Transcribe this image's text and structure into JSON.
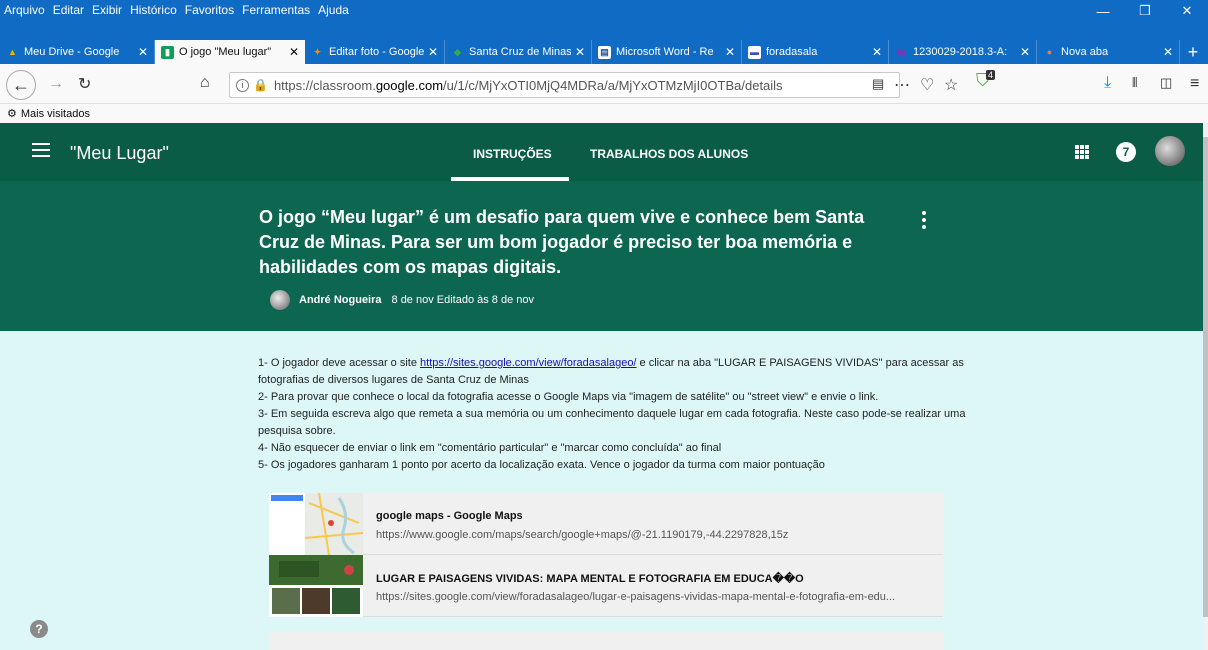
{
  "menu": [
    "Arquivo",
    "Editar",
    "Exibir",
    "Histórico",
    "Favoritos",
    "Ferramentas",
    "Ajuda"
  ],
  "window_controls": [
    "—",
    "❐",
    "✕"
  ],
  "tabs": [
    {
      "label": "Meu Drive - Google",
      "icon": "▲",
      "color": "#f4b400"
    },
    {
      "label": "O jogo \"Meu lugar\"",
      "icon": "▮",
      "color": "#0f9d58"
    },
    {
      "label": "Editar foto - Google",
      "icon": "✦",
      "color": "#ff8a00"
    },
    {
      "label": "Santa Cruz de Minas",
      "icon": "◆",
      "color": "#34a853"
    },
    {
      "label": "Microsoft Word - Re",
      "icon": "▤",
      "color": "#2b579a"
    },
    {
      "label": "foradasala",
      "icon": "▬",
      "color": "#3f51b5"
    },
    {
      "label": "1230029-2018.3-A:",
      "icon": "▥",
      "color": "#9c27b0"
    },
    {
      "label": "Nova aba",
      "icon": "●",
      "color": "#ff7139"
    }
  ],
  "url": {
    "pre": "https://classroom.",
    "domain": "google.com",
    "post": "/u/1/c/MjYxOTI0MjQ4MDRa/a/MjYxOTMzMjI0OTBa/details"
  },
  "bookmarks": {
    "label": "Mais visitados"
  },
  "badge_count": "4",
  "app": {
    "title": "\"Meu Lugar\"",
    "tab_instructions": "INSTRUÇÕES",
    "tab_work": "TRABALHOS DOS ALUNOS",
    "notifications": "7"
  },
  "assignment": {
    "title": "O jogo “Meu lugar” é um desafio para quem vive e conhece bem Santa Cruz de Minas. Para ser um bom jogador é preciso ter boa memória e habilidades com os mapas digitais.",
    "author": "André Nogueira",
    "date": "8 de nov Editado às 8 de nov"
  },
  "instructions": {
    "l1_pre": "1- O jogador deve acessar o site ",
    "l1_link": "https://sites.google.com/view/foradasalageo/",
    "l1_post": " e clicar na aba \"LUGAR E PAISAGENS VIVIDAS\" para acessar as fotografias de diversos lugares de Santa Cruz de Minas",
    "l2": "2- Para provar que conhece o local da fotografia acesse o Google Maps via \"imagem de satélite\" ou \"street view\" e envie o link.",
    "l3": "3- Em seguida escreva algo que remeta a sua memória ou um conhecimento daquele lugar em cada fotografia. Neste caso pode-se realizar uma pesquisa sobre.",
    "l4": "4- Não esquecer de enviar o link em \"comentário particular\" e \"marcar como concluída\" ao final",
    "l5": "5- Os jogadores ganharam 1 ponto por acerto da localização exata. Vence o jogador da turma com maior pontuação"
  },
  "attachments": [
    {
      "title": "google maps - Google Maps",
      "url": "https://www.google.com/maps/search/google+maps/@-21.1190179,-44.2297828,15z"
    },
    {
      "title": "LUGAR E PAISAGENS VIVIDAS: MAPA MENTAL E FOTOGRAFIA EM EDUCA��O",
      "url": "https://sites.google.com/view/foradasalageo/lugar-e-paisagens-vividas-mapa-mental-e-fotografia-em-edu..."
    }
  ]
}
